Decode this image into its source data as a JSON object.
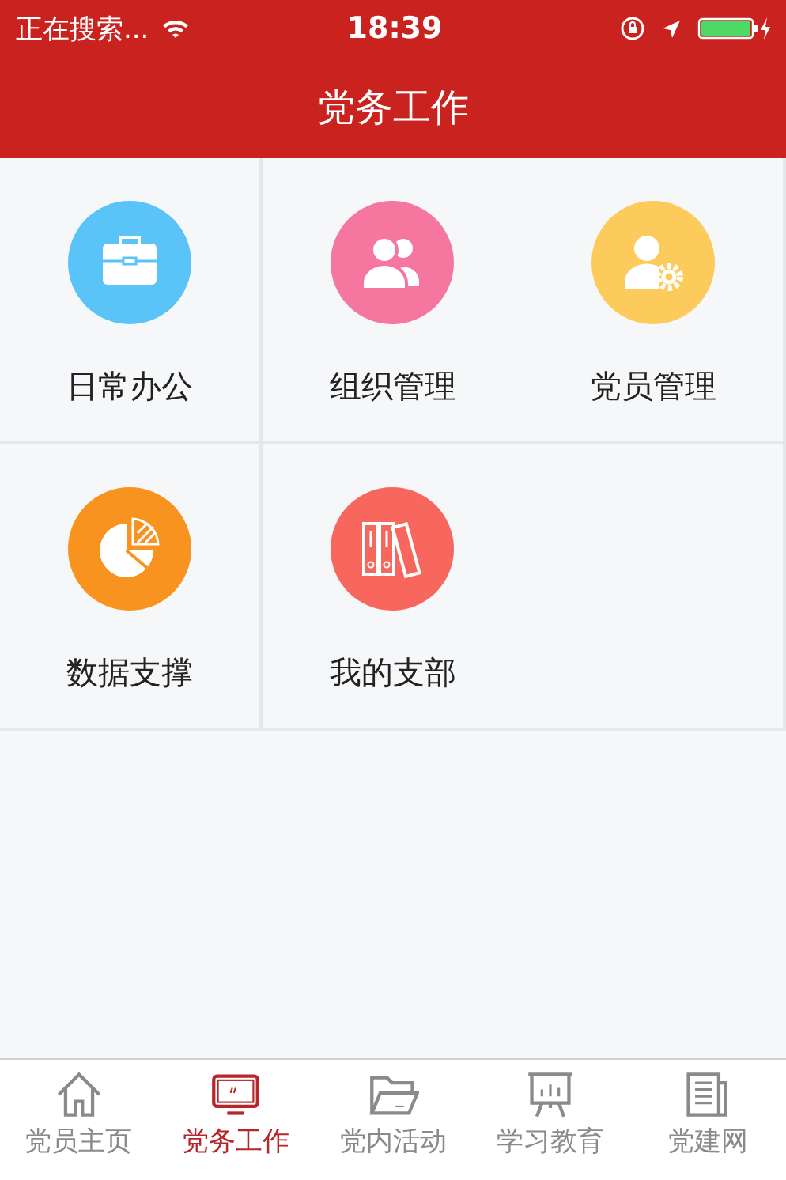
{
  "status_bar": {
    "carrier": "正在搜索...",
    "time": "18:39"
  },
  "nav_bar": {
    "title": "党务工作"
  },
  "grid": {
    "items": [
      {
        "label": "日常办公",
        "kind": "briefcase",
        "color": "#5ac4f8"
      },
      {
        "label": "组织管理",
        "kind": "people",
        "color": "#f577a0"
      },
      {
        "label": "党员管理",
        "kind": "person-gear",
        "color": "#fccb5c"
      },
      {
        "label": "数据支撑",
        "kind": "pie",
        "color": "#f7931e"
      },
      {
        "label": "我的支部",
        "kind": "binders",
        "color": "#f7675d"
      }
    ]
  },
  "tab_bar": {
    "tabs": [
      {
        "label": "党员主页",
        "kind": "house",
        "selected": false
      },
      {
        "label": "党务工作",
        "kind": "monitor",
        "selected": true
      },
      {
        "label": "党内活动",
        "kind": "folder",
        "selected": false
      },
      {
        "label": "学习教育",
        "kind": "easel",
        "selected": false
      },
      {
        "label": "党建网",
        "kind": "newspaper",
        "selected": false
      }
    ]
  }
}
